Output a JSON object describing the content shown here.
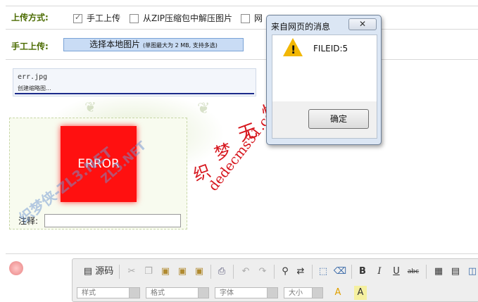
{
  "upload_mode": {
    "label": "上传方式:",
    "options": [
      {
        "label": "手工上传",
        "checked": true
      },
      {
        "label": "从ZIP压缩包中解压图片",
        "checked": false
      },
      {
        "label": "网",
        "checked": false
      }
    ]
  },
  "manual_upload": {
    "label": "手工上传:",
    "button_label": "选择本地图片",
    "button_hint": "(单图最大为 2 MB, 支持多选)"
  },
  "file_item": {
    "name": "err.jpg",
    "status": "创建缩略图..."
  },
  "thumbnail": {
    "error_text": "ERROR",
    "note_label": "注释:",
    "note_value": ""
  },
  "dialog": {
    "title": "来自网页的消息",
    "close_icon": "close-icon",
    "message": "FILEID:5",
    "ok_label": "确定",
    "icon": "warning-icon"
  },
  "watermarks": {
    "red_chars": [
      "织",
      "梦",
      "无",
      "忧"
    ],
    "red_url": "dedecms51.com",
    "blue_left": "织梦侠-ZL3.NET",
    "blue_mid": "ZL3.NET"
  },
  "editor_toolbar": {
    "source_label": "源码",
    "bold": "B",
    "italic": "I",
    "underline": "U",
    "strike": "abc",
    "combos": [
      "样式",
      "格式",
      "字体",
      "大小"
    ]
  },
  "colors": {
    "label_green": "#4b6b00",
    "error_red": "#ff1010",
    "watermark_red": "#d6151c",
    "progress_blue": "#1b2a8a"
  }
}
